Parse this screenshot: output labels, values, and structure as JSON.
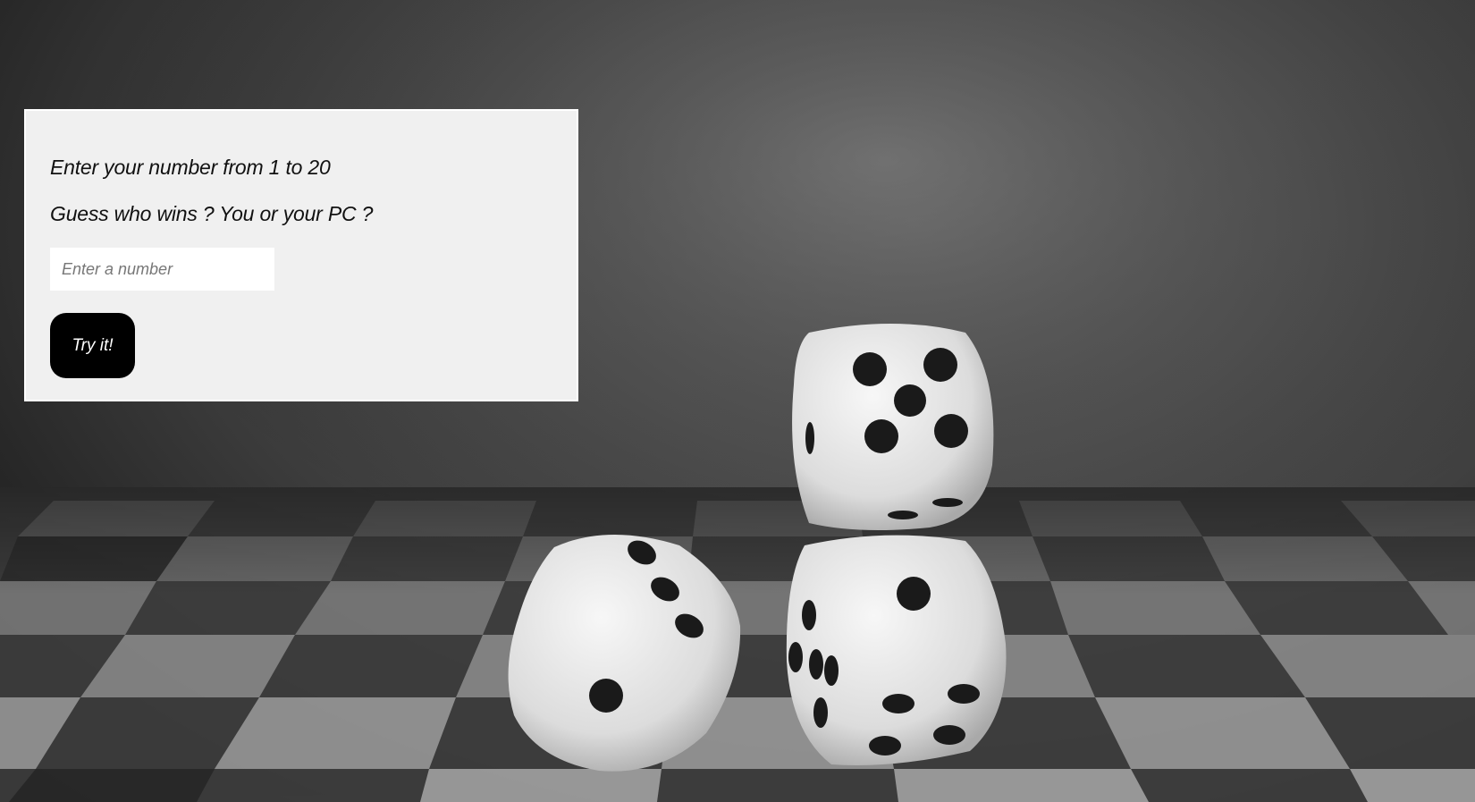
{
  "form": {
    "heading_primary": "Enter your number from 1 to 20",
    "heading_secondary": "Guess who wins ? You or your PC ?",
    "input_placeholder": "Enter a number",
    "input_value": "",
    "button_label": "Try it!"
  },
  "background": {
    "image_subject": "three white dice on a chessboard",
    "colors": {
      "panel": "#f0f0f0",
      "button": "#000000",
      "button_text": "#ffffff"
    }
  }
}
